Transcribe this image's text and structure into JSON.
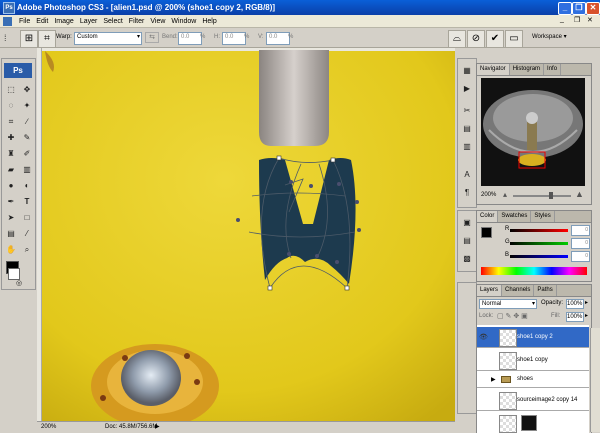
{
  "app": {
    "title": "Adobe Photoshop CS3 - [alien1.psd @ 200% (shoe1 copy 2, RGB/8)]",
    "app_icon": "Ps"
  },
  "window_controls": {
    "minimize": "_",
    "restore": "❐",
    "close": "✕"
  },
  "menubar": {
    "items": [
      "File",
      "Edit",
      "Image",
      "Layer",
      "Select",
      "Filter",
      "View",
      "Window",
      "Help"
    ],
    "doc_controls": {
      "minimize": "_",
      "restore": "❐",
      "close": "✕"
    }
  },
  "options": {
    "warp_label": "Warp:",
    "warp_value": "Custom",
    "bend_label": "Bend:",
    "bend_value": "0.0",
    "bend_unit": "%",
    "h_label": "H:",
    "h_value": "0.0",
    "h_unit": "%",
    "v_label": "V:",
    "v_value": "0.0",
    "v_unit": "%",
    "workspace_label": "Workspace ▾"
  },
  "toolbox": {
    "logo": "Ps"
  },
  "status": {
    "zoom": "200%",
    "doc": "Doc: 45.8M/756.6M"
  },
  "navigator": {
    "tabs": [
      "Navigator",
      "Histogram",
      "Info"
    ],
    "zoom": "200%"
  },
  "color": {
    "tabs": [
      "Color",
      "Swatches",
      "Styles"
    ],
    "channels": [
      {
        "label": "R",
        "value": "0",
        "color": "#d01010"
      },
      {
        "label": "G",
        "value": "0",
        "color": "#10a010"
      },
      {
        "label": "B",
        "value": "0",
        "color": "#1030d0"
      }
    ]
  },
  "layers": {
    "tabs": [
      "Layers",
      "Channels",
      "Paths"
    ],
    "blend_mode": "Normal",
    "opacity_label": "Opacity:",
    "opacity_value": "100%",
    "lock_label": "Lock:",
    "fill_label": "Fill:",
    "fill_value": "100%",
    "rows": [
      {
        "name": "shoe1 copy 2",
        "selected": true,
        "visible": true
      },
      {
        "name": "shoe1 copy",
        "selected": false,
        "visible": false
      },
      {
        "name": "shoes",
        "selected": false,
        "visible": false,
        "group": true
      },
      {
        "name": "sourceimage2 copy 14",
        "selected": false,
        "visible": false
      }
    ]
  },
  "colors": {
    "accent": "#3169c6",
    "canvas_yellow": "#e6cf1f",
    "titlebar": "#0a4fc0"
  }
}
